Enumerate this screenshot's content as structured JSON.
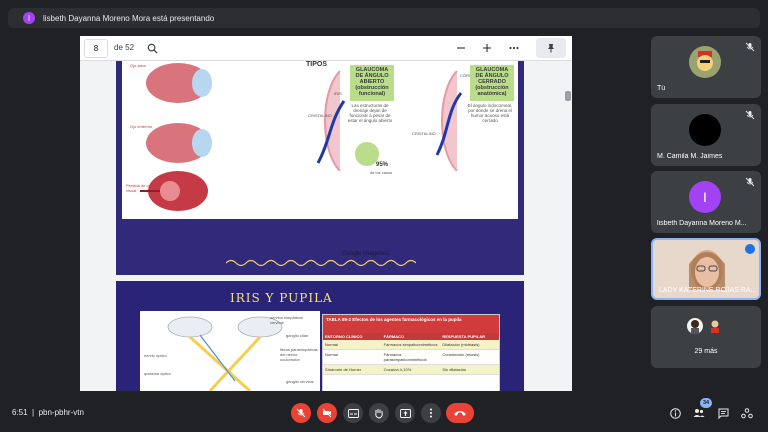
{
  "banner": {
    "text": "lisbeth Dayanna Moreno Mora está presentando",
    "avatar_letter": "l",
    "avatar_color": "#a142f4"
  },
  "viewer": {
    "page_number": "8",
    "page_total": "de 52",
    "search_icon": "search-icon",
    "zoom_out_icon": "minus-icon",
    "zoom_in_icon": "plus-icon",
    "more_icon": "more-horiz-icon",
    "pin_icon": "pin-icon"
  },
  "slide1": {
    "heading": "TIPOS",
    "green_box_1": "GLAUCOMA DE ÁNGULO ABIERTO (obstrucción funcional)",
    "green_box_2": "GLAUCOMA DE ÁNGULO CERRADO (obstrucción anatómica)",
    "desc_1": "Las estructuras de drenaje dejan de funcionar a pesar de estar el ángulo abierto",
    "desc_2": "El ángulo iridocorneal, por donde se drena el humor acuoso está cerrado",
    "percent": "95%",
    "percent_caption": "de los casos",
    "label_iris": "IRIS",
    "label_cristalino_1": "CRISTALINO",
    "label_cristalino_2": "CRISTALINO",
    "label_cornea": "CÓRNEA",
    "label_ojo_enfermo": "Ojo enfermo",
    "label_sano": "Ojo sano",
    "label_perdida": "Pérdida de campo visual",
    "caption": "Google imágenes"
  },
  "slide2": {
    "title": "IRIS Y PUPILA",
    "table_title": "TABLA 89-2 Efectos de los agentes farmacológicos en la pupila",
    "columns": [
      "ENTORNO CLÍNICO",
      "FÁRMACO",
      "RESPUESTA PUPILAR"
    ],
    "rows": [
      [
        "Normal",
        "Fármacos simpaticomiméticos",
        "Dilatación (midriasis)"
      ],
      [
        "Normal",
        "Fármacos parasimpaticomiméticos",
        "Constricción (miosis)"
      ],
      [
        "Síndrome de Horner",
        "Cocaína 4-10%",
        "Sin dilatación"
      ]
    ],
    "diagram_labels": [
      "nervios simpáticos cervical",
      "ganglio ciliar",
      "fibras parasimpáticas del nervio oculomotor",
      "nervio óptico",
      "quiasma óptico",
      "ganglio cervical"
    ]
  },
  "participants": [
    {
      "name": "Tú",
      "avatar": "cartoon-avatar",
      "color": "#7a8a6a"
    },
    {
      "name": "M. Camila M. Jaimes",
      "avatar": "",
      "color": "#000000"
    },
    {
      "name": "lisbeth Dayanna Moreno M...",
      "avatar": "I",
      "color": "#a142f4"
    },
    {
      "name": "LADY KATERINE ROJAS RA...",
      "avatar": "video",
      "color": "#e6c9b4"
    },
    {
      "name": "29 más",
      "avatar": "",
      "color": "#3c4043"
    }
  ],
  "bottom": {
    "time": "6:51",
    "separator": "|",
    "meeting_code": "pbn-pbhr-vtn",
    "people_count": "34"
  },
  "colors": {
    "background": "#202124",
    "tile": "#3c4043",
    "danger": "#ea4335",
    "accent": "#8ab4f8"
  }
}
